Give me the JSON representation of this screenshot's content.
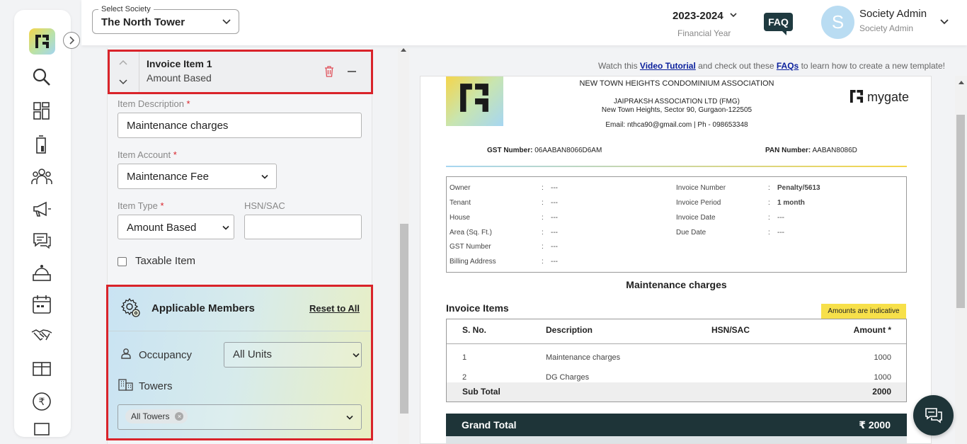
{
  "header": {
    "society_label": "Select Society",
    "society_value": "The North Tower",
    "financial_year": "2023-2024",
    "financial_year_label": "Financial Year",
    "faq": "FAQ",
    "avatar_initial": "S",
    "user_name": "Society Admin",
    "user_role": "Society Admin"
  },
  "sidebar": {
    "items": [
      "search-icon",
      "dashboard-icon",
      "building-icon",
      "residents-icon",
      "announcement-icon",
      "chat-icon",
      "helpdesk-icon",
      "calendar-icon",
      "handshake-icon",
      "amenities-icon",
      "rupee-icon",
      "more-icon"
    ]
  },
  "invoice_item": {
    "title": "Invoice Item 1",
    "subtitle": "Amount Based",
    "description_label": "Item Description",
    "description_value": "Maintenance charges",
    "account_label": "Item Account",
    "account_value": "Maintenance Fee",
    "type_label": "Item Type",
    "type_value": "Amount Based",
    "hsn_label": "HSN/SAC",
    "hsn_value": "",
    "taxable_label": "Taxable Item",
    "required_mark": "*"
  },
  "members": {
    "title": "Applicable Members",
    "reset": "Reset to All",
    "occupancy_label": "Occupancy",
    "occupancy_value": "All Units",
    "towers_label": "Towers",
    "towers_chip": "All Towers"
  },
  "watch": {
    "prefix": "Watch this ",
    "video_link": "Video Tutorial",
    "middle": " and check out these ",
    "faq_link": "FAQs",
    "suffix": " to learn how to create a new template!"
  },
  "invoice": {
    "assoc_name": "NEW TOWN HEIGHTS CONDOMINIUM ASSOCIATION",
    "assoc_sub": "JAIPRAKSH ASSOCIATION LTD (FMG)",
    "address": "New Town Heights, Sector 90, Gurgaon-122505",
    "contact": "Email: nthca90@gmail.com | Ph - 098653348",
    "brand": "mygate",
    "gst_label": "GST Number:",
    "gst_value": "06AABAN8066D6AM",
    "pan_label": "PAN Number:",
    "pan_value": "AABAN8086D",
    "details_left": [
      {
        "label": "Owner",
        "value": "---"
      },
      {
        "label": "Tenant",
        "value": "---"
      },
      {
        "label": "House",
        "value": "---"
      },
      {
        "label": "Area (Sq. Ft.)",
        "value": "---"
      },
      {
        "label": "GST Number",
        "value": "---"
      },
      {
        "label": "Billing Address",
        "value": "---"
      }
    ],
    "details_right": [
      {
        "label": "Invoice Number",
        "value": "Penalty/5613"
      },
      {
        "label": "Invoice Period",
        "value": "1 month"
      },
      {
        "label": "Invoice Date",
        "value": "---"
      },
      {
        "label": "Due Date",
        "value": "---"
      }
    ],
    "section_title": "Maintenance charges",
    "items_label": "Invoice Items",
    "indicative": "Amounts are indicative",
    "columns": {
      "sno": "S. No.",
      "desc": "Description",
      "hsn": "HSN/SAC",
      "amount": "Amount *"
    },
    "rows": [
      {
        "sno": "1",
        "desc": "Maintenance charges",
        "amount": "1000"
      },
      {
        "sno": "2",
        "desc": "DG Charges",
        "amount": "1000"
      }
    ],
    "subtotal_label": "Sub Total",
    "subtotal_value": "2000",
    "grand_label": "Grand Total",
    "grand_value": "₹ 2000"
  },
  "colors": {
    "accent_red": "#d9232a",
    "dark": "#1e3438",
    "link": "#0a1f9c",
    "badge": "#f7e04a"
  }
}
